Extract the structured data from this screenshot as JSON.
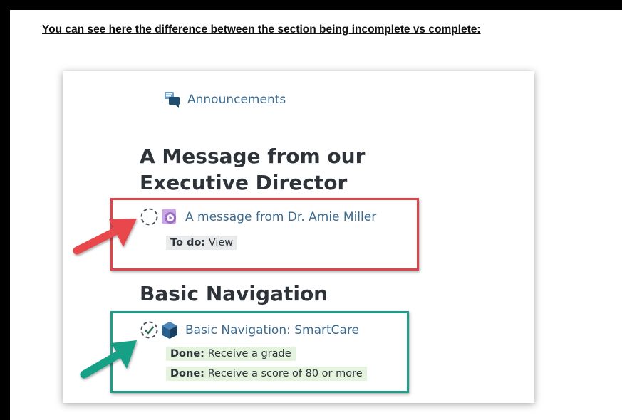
{
  "caption": "You can see here the difference between the section being incomplete vs complete:",
  "announcements": {
    "label": "Announcements",
    "icon": "announcements-chat-icon"
  },
  "section1": {
    "title": "A Message from our Executive Director",
    "item": {
      "title": "A message from Dr. Amie Miller",
      "status_icon": "incomplete-dashed-circle-icon",
      "activity_icon": "video-play-icon",
      "requirements": [
        {
          "label": "To do:",
          "value": "View"
        }
      ]
    }
  },
  "section2": {
    "title": "Basic Navigation",
    "item": {
      "title": "Basic Navigation: SmartCare",
      "status_icon": "complete-check-circle-icon",
      "activity_icon": "scorm-package-cube-icon",
      "requirements": [
        {
          "label": "Done:",
          "value": "Receive a grade"
        },
        {
          "label": "Done:",
          "value": "Receive a score of 80 or more"
        }
      ]
    }
  },
  "colors": {
    "incomplete_highlight": "#e0444a",
    "complete_highlight": "#1e9e8a",
    "link": "#3b6b8f",
    "done_badge_bg": "#e3f3de",
    "todo_badge_bg": "#e8eaec"
  }
}
